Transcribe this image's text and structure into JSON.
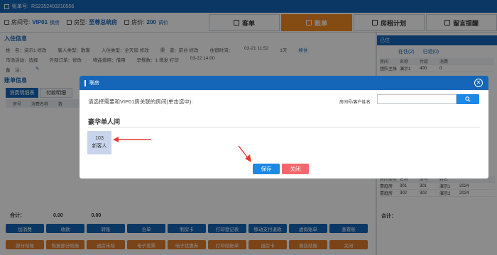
{
  "topbar": {
    "label": "账单号:",
    "bill_no": "RS2352403210556"
  },
  "infobar": {
    "room_label": "房间号:",
    "room_value": "VIP01",
    "room_action": "换房",
    "type_label": "房型:",
    "type_value": "至尊总统房",
    "price_label": "房价:",
    "price_value": "200",
    "price_action": "调价"
  },
  "tabs": [
    {
      "label": "客单",
      "active": false
    },
    {
      "label": "账单",
      "active": true
    },
    {
      "label": "房租计划",
      "active": false
    },
    {
      "label": "留言提醒",
      "active": false
    }
  ],
  "checkin": {
    "title": "入住信息",
    "name": "姓　名：演示1 修改",
    "guest_type": "客人类型：散客",
    "checkin_type": "入住类型：全天房 修改",
    "channel": "渠　道：前台 修改",
    "stay_label": "住宿时间：",
    "stay_in": "03-21 11:52",
    "stay_out": "03-22 14:00",
    "stay_days": "1天",
    "stay_action": "续住",
    "activity": "市场活动：选择",
    "order": "外部订单：修改",
    "deposit": "物品借用：借用",
    "breakfast": "早餐数：1 增发 打印",
    "note": "备　注：",
    "bill_title": "账单信息"
  },
  "subtabs": [
    {
      "label": "消费明细表",
      "active": true
    },
    {
      "label": "付款明细",
      "active": false
    }
  ],
  "bill_table": {
    "headers": [
      "房号",
      "消费名称",
      "数"
    ]
  },
  "totals": {
    "label": "合计：",
    "v1": "0.00",
    "v2": "0.00"
  },
  "buttons_row1": [
    "加消费",
    "收款",
    "转账",
    "合单",
    "制房卡",
    "打印登记表",
    "移动支付退款",
    "虚拟账单",
    "查看账"
  ],
  "buttons_row2": [
    "部分结账",
    "恢复部分结账",
    "退房未结",
    "电子发票",
    "电子优惠券",
    "打印结账单",
    "退房卡",
    "离店结账",
    "关闭"
  ],
  "right_panel": {
    "header": "已住",
    "radio_in": "在住(2)",
    "radio_left": "已退(0)",
    "table1_headers": [
      "房间",
      "名称",
      "付款",
      "消费"
    ],
    "table1_rows": [
      [
        "团队主账",
        "演示1",
        "400",
        "0"
      ]
    ],
    "table2_headers": [
      "房间类型",
      "名称",
      "房号",
      "姓名"
    ],
    "table2_rows": [
      [
        "豪庭房",
        "301",
        "301",
        "演示1",
        "2024"
      ],
      [
        "豪庭房",
        "302",
        "302",
        "演示2",
        "2024"
      ]
    ],
    "total_label": "合计："
  },
  "modal": {
    "title": "联房",
    "prompt": "请选择需要和VIP01房关联的房间(单击选中):",
    "search_label": "房间号/客户姓名",
    "search_placeholder": "",
    "section": "豪华单人间",
    "room_no": "103",
    "room_guest": "新客人",
    "save": "保存",
    "close": "关闭"
  }
}
